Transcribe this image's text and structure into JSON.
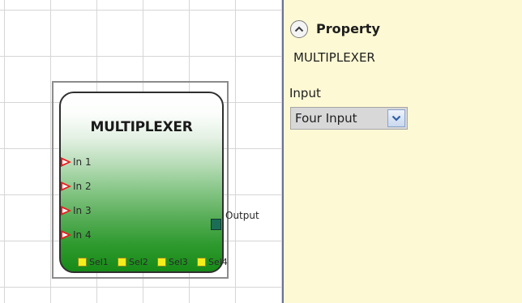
{
  "canvas": {
    "block": {
      "title": "MULTIPLEXER",
      "inputs": [
        "In 1",
        "In 2",
        "In 3",
        "In 4"
      ],
      "output": "Output",
      "selectors": [
        "Sel1",
        "Sel2",
        "Sel3",
        "Sel4"
      ]
    }
  },
  "property_panel": {
    "title": "Property",
    "subtitle": "MULTIPLEXER",
    "input_label": "Input",
    "input_value": "Four Input",
    "icons": {
      "collapse": "chevron-up-icon",
      "dropdown": "chevron-down-icon",
      "input_port": "triangle-right-icon",
      "output_port": "square-icon",
      "selector_port": "square-icon"
    }
  },
  "colors": {
    "panel_bg": "#fdf9d4",
    "input_arrow": "#e51f1f",
    "output_port": "#1b6e55",
    "selector_port": "#f5ee1a",
    "block_gradient_bottom": "#178a17"
  }
}
